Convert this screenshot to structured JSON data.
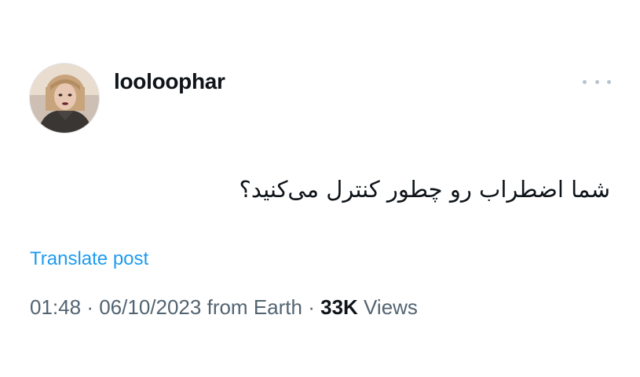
{
  "author": {
    "username": "looloophar",
    "avatar_icon": "profile-photo"
  },
  "post": {
    "text": "شما اضطراب رو چطور کنترل می‌کنید؟"
  },
  "actions": {
    "translate_label": "Translate post",
    "more_icon": "ellipsis-icon"
  },
  "meta": {
    "time": "01:48",
    "separator": "·",
    "date": "06/10/2023",
    "source": "from Earth",
    "views_count": "33K",
    "views_label": "Views"
  },
  "colors": {
    "link": "#1d9bf0",
    "text_primary": "#0f1419",
    "text_secondary": "#536471"
  }
}
